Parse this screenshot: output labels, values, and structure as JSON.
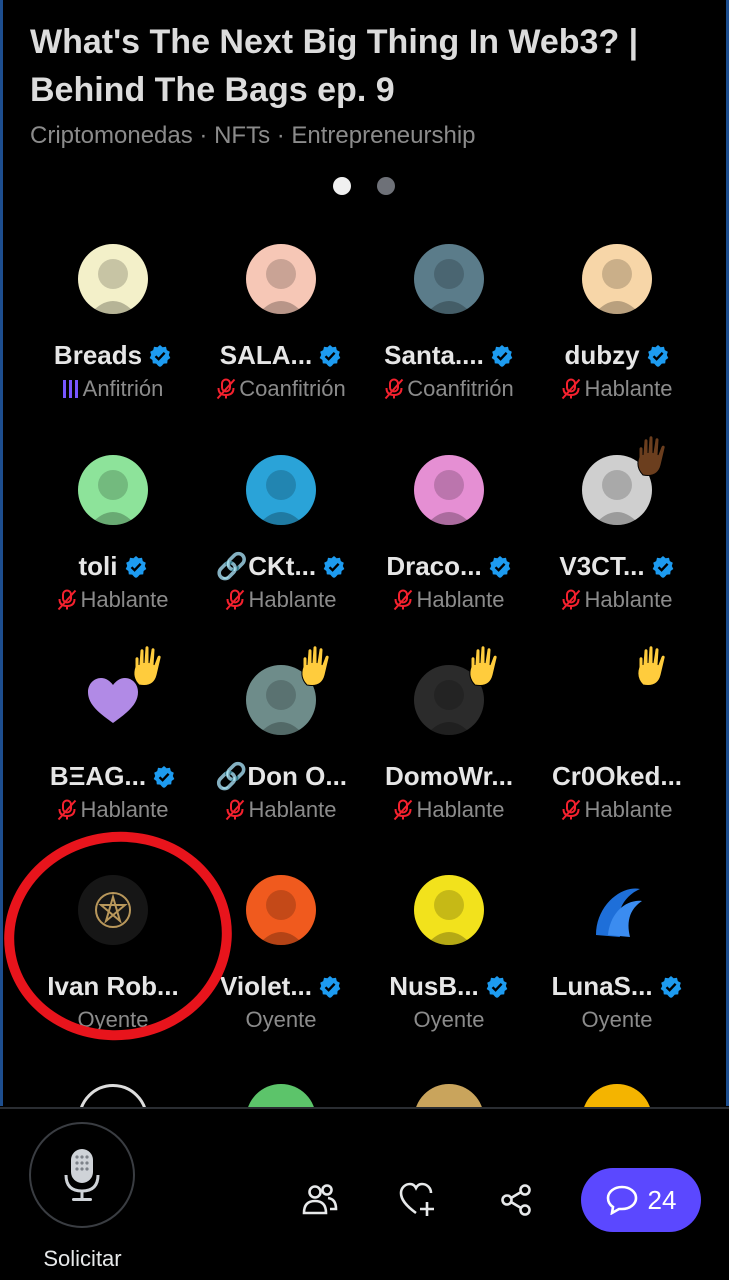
{
  "header": {
    "title": "What's The Next Big Thing In Web3? | Behind The Bags ep. 9",
    "tags": "Criptomonedas · NFTs · Entrepreneurship"
  },
  "pager": {
    "count": 2,
    "active": 0
  },
  "participants": [
    {
      "name": "Breads",
      "verified": true,
      "role": "Anfitrión",
      "role_icon": "host-bars-icon",
      "avatar_color": "#f3f0c9"
    },
    {
      "name": "SALA...",
      "verified": true,
      "role": "Coanfitrión",
      "role_icon": "mic-off-icon",
      "avatar_color": "#f6c7b6"
    },
    {
      "name": "Santa....",
      "verified": true,
      "role": "Coanfitrión",
      "role_icon": "mic-off-icon",
      "avatar_color": "#5b7c8a"
    },
    {
      "name": "dubzy",
      "verified": true,
      "role": "Hablante",
      "role_icon": "mic-off-icon",
      "avatar_color": "#f7d6a8"
    },
    {
      "name": "toli",
      "verified": true,
      "role": "Hablante",
      "role_icon": "mic-off-icon",
      "avatar_color": "#8de39a"
    },
    {
      "name": "🔗CKt...",
      "verified": true,
      "role": "Hablante",
      "role_icon": "mic-off-icon",
      "avatar_color": "#2aa3d8"
    },
    {
      "name": "Draco...",
      "verified": true,
      "role": "Hablante",
      "role_icon": "mic-off-icon",
      "avatar_color": "#e58fd3"
    },
    {
      "name": "V3CT...",
      "verified": true,
      "role": "Hablante",
      "role_icon": "mic-off-icon",
      "avatar_color": "#cfcfcf",
      "hand": "dark"
    },
    {
      "name": "BΞAG...",
      "verified": true,
      "role": "Hablante",
      "role_icon": "mic-off-icon",
      "avatar_color": "#000000",
      "hand": "yellow",
      "heart": true
    },
    {
      "name": "🔗Don O...",
      "verified": false,
      "role": "Hablante",
      "role_icon": "mic-off-icon",
      "avatar_color": "#6e8c8a",
      "hand": "yellow"
    },
    {
      "name": "DomoWr...",
      "verified": false,
      "role": "Hablante",
      "role_icon": "mic-off-icon",
      "avatar_color": "#2b2b2b",
      "hand": "yellow"
    },
    {
      "name": "Cr0Oked...",
      "verified": false,
      "role": "Hablante",
      "role_icon": "mic-off-icon",
      "avatar_color": "#000000",
      "hand": "yellow"
    },
    {
      "name": "Ivan Rob...",
      "verified": false,
      "role": "Oyente",
      "role_icon": "none",
      "avatar_color": "#151515"
    },
    {
      "name": "Violet...",
      "verified": true,
      "role": "Oyente",
      "role_icon": "none",
      "avatar_color": "#f05a1e"
    },
    {
      "name": "NusB...",
      "verified": true,
      "role": "Oyente",
      "role_icon": "none",
      "avatar_color": "#f2e21c"
    },
    {
      "name": "LunaS...",
      "verified": true,
      "role": "Oyente",
      "role_icon": "none",
      "avatar_color": "#000000"
    }
  ],
  "bottom_bar": {
    "request_label": "Solicitar",
    "chat_count": "24",
    "accent_color": "#5b48ff",
    "icons": [
      "people-icon",
      "heart-plus-icon",
      "share-icon",
      "chat-bubble-icon"
    ]
  },
  "colors": {
    "verified": "#1d9bf0",
    "mic_off": "#f4212e",
    "host": "#7856ff",
    "annotation": "#e8141c"
  }
}
